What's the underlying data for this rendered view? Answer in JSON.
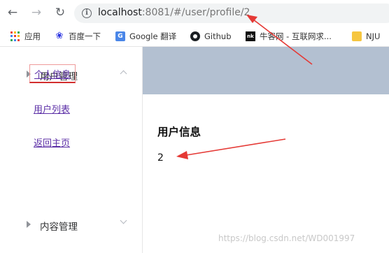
{
  "browser": {
    "nav": {
      "back_icon": "arrow-left-icon",
      "forward_icon": "arrow-right-icon",
      "reload_icon": "reload-icon"
    },
    "address_bar": {
      "host": "localhost",
      "rest": ":8081/#/user/profile/2"
    },
    "bookmarks": [
      {
        "label": "应用",
        "icon": "apps-grid-icon"
      },
      {
        "label": "百度一下",
        "icon": "baidu-paw-icon"
      },
      {
        "label": "Google 翻译",
        "icon": "google-translate-icon"
      },
      {
        "label": "Github",
        "icon": "github-icon"
      },
      {
        "label": "牛客网 - 互联网求...",
        "icon": "nowcoder-icon"
      },
      {
        "label": "NJU",
        "icon": "folder-icon"
      }
    ]
  },
  "sidebar": {
    "groups": [
      {
        "label": "用户管理",
        "expanded": true
      },
      {
        "label": "内容管理",
        "expanded": false
      }
    ],
    "user_links": [
      {
        "label": "个人信息",
        "active": true
      },
      {
        "label": "用户列表",
        "active": false
      },
      {
        "label": "返回主页",
        "active": false
      }
    ]
  },
  "main": {
    "title": "用户信息",
    "user_id": "2"
  },
  "watermark": "https://blog.csdn.net/WD001997",
  "colors": {
    "header_band": "#b3c0d1",
    "link": "#5b2ea6",
    "active_outline": "#d32f2f",
    "annotation_arrow": "#e53935"
  }
}
